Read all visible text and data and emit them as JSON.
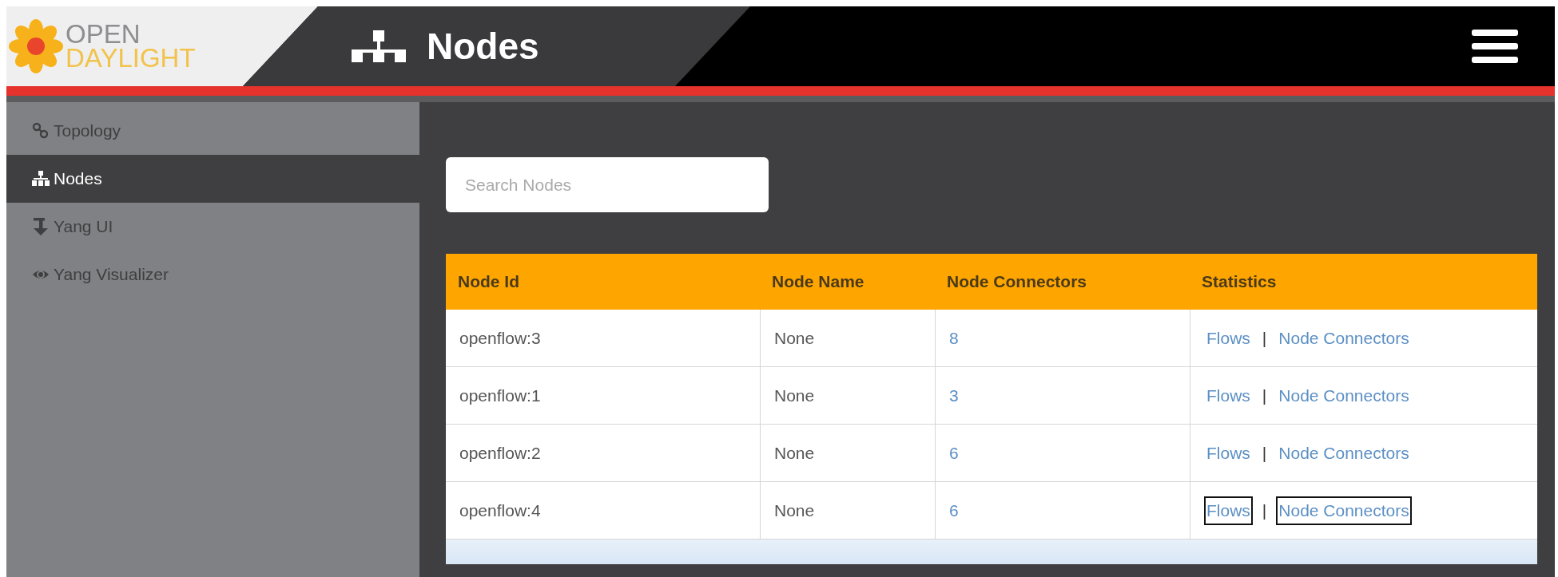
{
  "header": {
    "logo": [
      "OPEN",
      "DAYLIGHT"
    ],
    "title": "Nodes"
  },
  "sidebar": {
    "items": [
      {
        "label": "Topology",
        "selected": false
      },
      {
        "label": "Nodes",
        "selected": true
      },
      {
        "label": "Yang UI",
        "selected": false
      },
      {
        "label": "Yang Visualizer",
        "selected": false
      }
    ]
  },
  "search": {
    "placeholder": "Search Nodes"
  },
  "table": {
    "columns": [
      "Node Id",
      "Node Name",
      "Node Connectors",
      "Statistics"
    ],
    "rows": [
      {
        "node_id": "openflow:3",
        "node_name": "None",
        "node_connectors": "8",
        "statistics": [
          {
            "label": "Flows",
            "focused": false
          },
          {
            "label": "Node Connectors",
            "focused": false
          }
        ],
        "separator": "|"
      },
      {
        "node_id": "openflow:1",
        "node_name": "None",
        "node_connectors": "3",
        "statistics": [
          {
            "label": "Flows",
            "focused": false
          },
          {
            "label": "Node Connectors",
            "focused": false
          }
        ],
        "separator": "|"
      },
      {
        "node_id": "openflow:2",
        "node_name": "None",
        "node_connectors": "6",
        "statistics": [
          {
            "label": "Flows",
            "focused": false
          },
          {
            "label": "Node Connectors",
            "focused": false
          }
        ],
        "separator": "|"
      },
      {
        "node_id": "openflow:4",
        "node_name": "None",
        "node_connectors": "6",
        "statistics": [
          {
            "label": "Flows",
            "focused": true
          },
          {
            "label": "Node Connectors",
            "focused": true
          }
        ],
        "separator": "|"
      }
    ]
  }
}
